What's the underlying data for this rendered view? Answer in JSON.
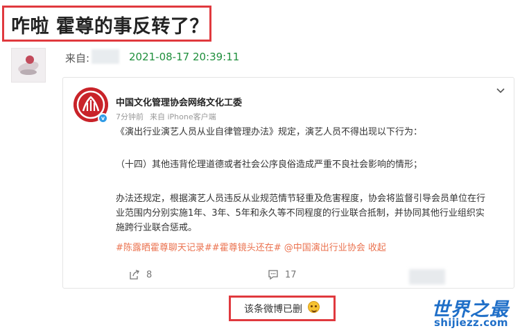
{
  "headline": "咋啦 霍尊的事反转了？",
  "post": {
    "from_label": "来自:",
    "timestamp": "2021-08-17 20:39:11"
  },
  "weibo": {
    "account_name": "中国文化管理协会网络文化工委",
    "time_ago": "7分钟前",
    "source": "来自 iPhone客户端",
    "paragraphs": [
      "《演出行业演艺人员从业自律管理办法》规定，演艺人员不得出现以下行为：",
      "（十四）其他违背伦理道德或者社会公序良俗造成严重不良社会影响的情形；",
      "办法还规定，根据演艺人员违反从业规范情节轻重及危害程度，协会将监督引导会员单位在行业范围内分别实施1年、3年、5年和永久等不同程度的行业联合抵制，并协同其他行业组织实施跨行业联合惩戒。"
    ],
    "tag1": "#陈露晒霍尊聊天记录#",
    "tag2": "#霍尊镜头还在#",
    "mention": "@中国演出行业协会",
    "collapse_label": "收起",
    "share_count": "8",
    "comment_count": "17"
  },
  "deleted_notice": "该条微博已删",
  "watermark": {
    "text": "世界之最",
    "url": "shijiezz.com"
  },
  "colors": {
    "highlight_border": "#e0393e",
    "timestamp_green": "#1f8f3c",
    "link_orange": "#eb7350",
    "watermark_blue": "#1f6fc8"
  },
  "icons": [
    "chevron-down-icon",
    "share-icon",
    "comment-icon",
    "verified-badge-icon",
    "laugh-emoji-icon"
  ]
}
